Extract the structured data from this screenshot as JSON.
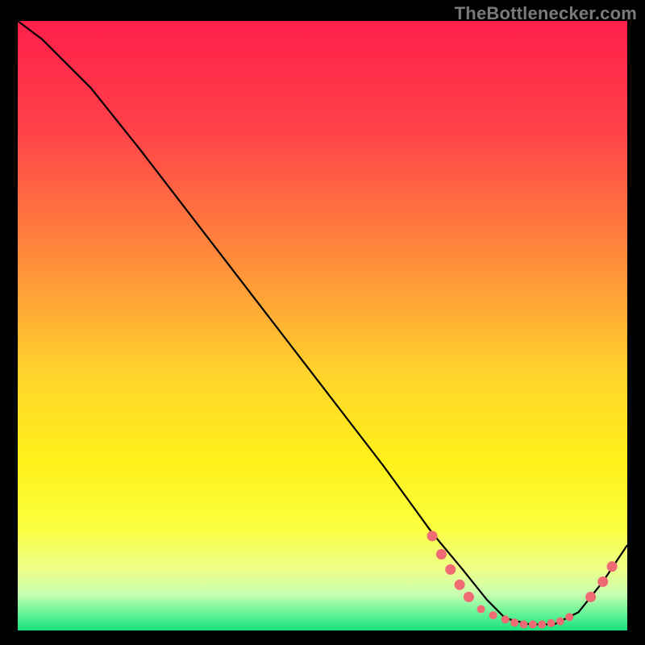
{
  "watermark": "TheBottlenecker.com",
  "chart_data": {
    "type": "line",
    "title": "",
    "xlabel": "",
    "ylabel": "",
    "xlim": [
      0,
      100
    ],
    "ylim": [
      0,
      100
    ],
    "grid": false,
    "background_gradient": {
      "stops": [
        {
          "offset": 0,
          "color": "#ff1f4b"
        },
        {
          "offset": 18,
          "color": "#ff4249"
        },
        {
          "offset": 40,
          "color": "#ff8f3a"
        },
        {
          "offset": 58,
          "color": "#ffd42c"
        },
        {
          "offset": 72,
          "color": "#fff01a"
        },
        {
          "offset": 83,
          "color": "#fbff3e"
        },
        {
          "offset": 90,
          "color": "#edff8a"
        },
        {
          "offset": 94,
          "color": "#c9ffb0"
        },
        {
          "offset": 97,
          "color": "#6cf598"
        },
        {
          "offset": 100,
          "color": "#16e27c"
        }
      ]
    },
    "series": [
      {
        "name": "curve",
        "color": "#000000",
        "x": [
          0,
          4,
          8,
          12,
          20,
          30,
          40,
          50,
          60,
          68,
          73,
          77,
          80,
          84,
          88,
          92,
          96,
          100
        ],
        "y": [
          100,
          97,
          93,
          89,
          79,
          66,
          53,
          40,
          27,
          16,
          10,
          5,
          2,
          1,
          1,
          3,
          8,
          14
        ]
      }
    ],
    "markers": {
      "color": "#ef6a72",
      "radius_small": 5,
      "radius_large": 6.5,
      "points": [
        {
          "x": 68.0,
          "y": 15.5,
          "r": "large"
        },
        {
          "x": 69.5,
          "y": 12.5,
          "r": "large"
        },
        {
          "x": 71.0,
          "y": 10.0,
          "r": "large"
        },
        {
          "x": 72.5,
          "y": 7.5,
          "r": "large"
        },
        {
          "x": 74.0,
          "y": 5.5,
          "r": "large"
        },
        {
          "x": 76.0,
          "y": 3.5,
          "r": "small"
        },
        {
          "x": 78.0,
          "y": 2.5,
          "r": "small"
        },
        {
          "x": 80.0,
          "y": 1.8,
          "r": "small"
        },
        {
          "x": 81.5,
          "y": 1.3,
          "r": "small"
        },
        {
          "x": 83.0,
          "y": 1.0,
          "r": "small"
        },
        {
          "x": 84.5,
          "y": 1.0,
          "r": "small"
        },
        {
          "x": 86.0,
          "y": 1.0,
          "r": "small"
        },
        {
          "x": 87.5,
          "y": 1.2,
          "r": "small"
        },
        {
          "x": 89.0,
          "y": 1.5,
          "r": "small"
        },
        {
          "x": 90.5,
          "y": 2.2,
          "r": "small"
        },
        {
          "x": 94.0,
          "y": 5.5,
          "r": "large"
        },
        {
          "x": 96.0,
          "y": 8.0,
          "r": "large"
        },
        {
          "x": 97.5,
          "y": 10.5,
          "r": "large"
        }
      ]
    }
  }
}
